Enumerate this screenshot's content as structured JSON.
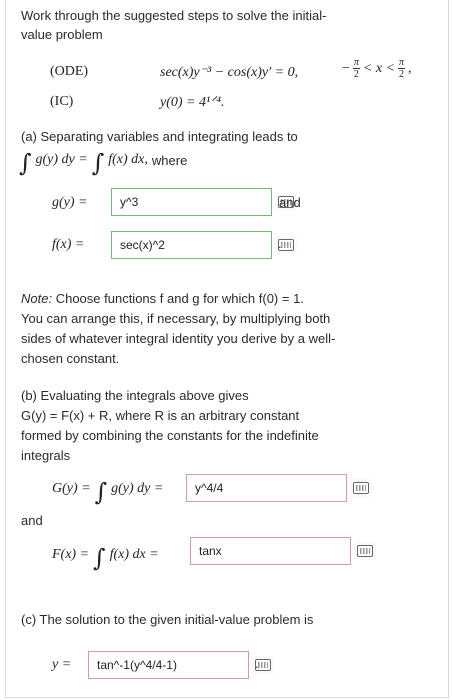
{
  "intro": {
    "line1": "Work through the suggested steps to solve the initial-",
    "line2": "value problem"
  },
  "problem": {
    "ode_tag": "(ODE)",
    "ode_equation": "sec(x)y⁻³ − cos(x)y′ = 0,",
    "ode_domain_left": "−",
    "ode_domain_mid": "< x <",
    "pi": "π",
    "two": "2",
    "comma": ",",
    "ic_tag": "(IC)",
    "ic_equation": "y(0) = 4¹ᐟ⁴."
  },
  "part_a": {
    "line1": "(a) Separating variables and integrating leads to",
    "integral_g": "g(y) dy =",
    "integral_f": "f(x) dx,",
    "where": "where",
    "g_label": "g(y) =",
    "g_value": "y^3",
    "and_label": "and",
    "f_label": "f(x) =",
    "f_value": "sec(x)^2",
    "period": "."
  },
  "note": {
    "label": "Note:",
    "line1": "Choose functions f and g for which f(0) = 1.",
    "line2": "You can arrange this, if necessary, by multiplying both",
    "line3": "sides of whatever integral identity you derive by a well-",
    "line4": "chosen constant."
  },
  "part_b": {
    "line1": "(b) Evaluating the integrals above gives",
    "line2": "G(y) = F(x) + R, where R is an arbitrary constant",
    "line3": "formed by combining the constants for the indefinite",
    "line4": "integrals",
    "G_label": "G(y) =",
    "G_integrand": "g(y) dy =",
    "G_value": "y^4/4",
    "and_label": "and",
    "F_label": "F(x) =",
    "F_integrand": "f(x) dx =",
    "F_value": "tanx"
  },
  "part_c": {
    "line1": "(c) The solution to the given initial-value problem is",
    "y_label": "y =",
    "y_value": "tan^-1(y^4/4-1)",
    "period": "."
  },
  "colors": {
    "correct_border": "#74b87a",
    "incorrect_border": "#d79a9a"
  },
  "icons": {
    "input_tool": "keyboard-icon"
  }
}
